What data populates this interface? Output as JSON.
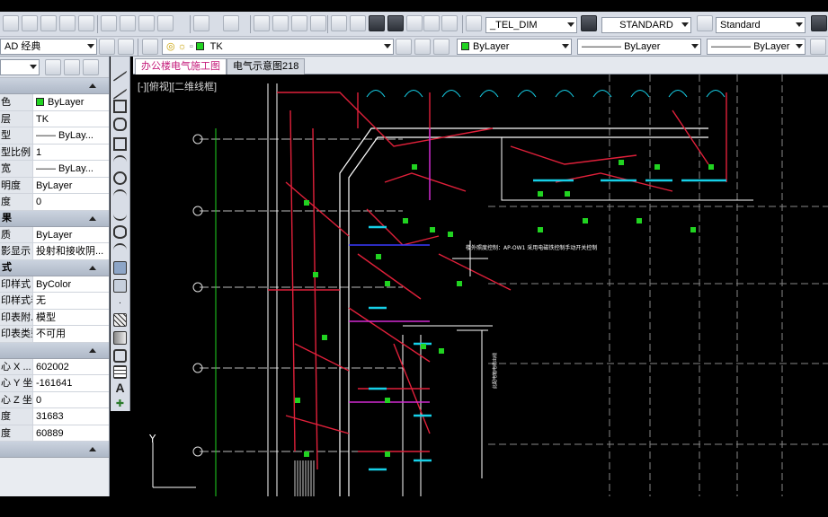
{
  "toolbar": {
    "textstyle_combo": "_TEL_DIM",
    "dimstyle_combo": "STANDARD",
    "tablestyle_combo": "Standard"
  },
  "layer_bar": {
    "workspace": "AD 经典",
    "layer_name": "TK",
    "color_combo": "ByLayer",
    "linetype_combo": "ByLayer",
    "lineweight_combo": "ByLayer"
  },
  "palette": {
    "section_general_rows": [
      {
        "key": "色",
        "value": "ByLayer",
        "swatch": true
      },
      {
        "key": "层",
        "value": "TK"
      },
      {
        "key": "型",
        "value": "—— ByLay..."
      },
      {
        "key": "型比例",
        "value": "1"
      },
      {
        "key": "宽",
        "value": "—— ByLay..."
      },
      {
        "key": "明度",
        "value": "ByLayer"
      },
      {
        "key": "度",
        "value": "0"
      }
    ],
    "section_3d_title": "果",
    "section_3d_rows": [
      {
        "key": "质",
        "value": "ByLayer"
      },
      {
        "key": "影显示",
        "value": "投射和接收阴..."
      }
    ],
    "section_plot_title": "式",
    "section_plot_rows": [
      {
        "key": "印样式",
        "value": "ByColor"
      },
      {
        "key": "印样式表",
        "value": "无"
      },
      {
        "key": "印表附...",
        "value": "模型"
      },
      {
        "key": "印表类型",
        "value": "不可用"
      }
    ],
    "section_view_rows": [
      {
        "key": "心 X ...",
        "value": "602002"
      },
      {
        "key": "心 Y 坐...",
        "value": "-161641"
      },
      {
        "key": "心 Z 坐...",
        "value": "0"
      },
      {
        "key": "度",
        "value": "31683"
      },
      {
        "key": "度",
        "value": "60889"
      }
    ]
  },
  "tabs": [
    {
      "label": "办公楼电气施工图",
      "active": true
    },
    {
      "label": "电气示意图218",
      "active": false
    }
  ],
  "viewport_label": "[-][俯视][二维线框]",
  "drawing": {
    "annotation_main": "楼外照度控制：AP-OW1 采用电磁铁控制手动开关控制",
    "annotation_small": "此配电箱电缆出线",
    "axis_y_label": "Y",
    "colors": {
      "wall": "#e0203a",
      "grid": "#ffffff",
      "text": "#ffffff",
      "symbol": "#21d321",
      "cyan": "#16d0e8",
      "magenta": "#d12bd1",
      "blue": "#3a3aff"
    }
  }
}
